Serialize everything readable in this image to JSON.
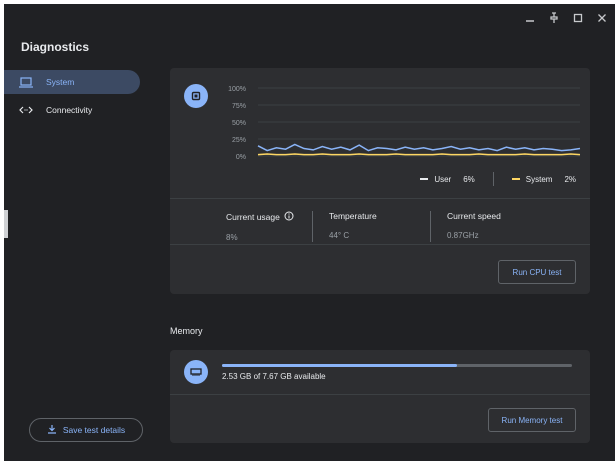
{
  "app": {
    "title": "Diagnostics"
  },
  "window_controls": [
    "minimize",
    "pin",
    "maximize",
    "close"
  ],
  "sidebar": {
    "items": [
      {
        "label": "System",
        "icon": "laptop-icon",
        "active": true
      },
      {
        "label": "Connectivity",
        "icon": "arrows-icon",
        "active": false
      }
    ],
    "save_button": "Save test details"
  },
  "cpu": {
    "y_ticks": [
      "100%",
      "75%",
      "50%",
      "25%",
      "0%"
    ],
    "legend": {
      "user_label": "User",
      "user_value": "6%",
      "system_label": "System",
      "system_value": "2%"
    },
    "stats": {
      "usage_label": "Current usage",
      "usage_value": "8%",
      "temp_label": "Temperature",
      "temp_value": "44° C",
      "speed_label": "Current speed",
      "speed_value": "0.87GHz"
    },
    "run_button": "Run CPU test"
  },
  "memory": {
    "section_title": "Memory",
    "available_text": "2.53 GB of 7.67 GB available",
    "used_fraction": 0.67,
    "run_button": "Run Memory test"
  },
  "colors": {
    "accent": "#8ab4f8",
    "user_line": "#8ab4f8",
    "system_line": "#fdd663"
  },
  "chart_data": {
    "type": "line",
    "ylim": [
      0,
      100
    ],
    "series": [
      {
        "name": "User",
        "values": [
          15,
          8,
          12,
          10,
          17,
          11,
          9,
          14,
          10,
          13,
          9,
          16,
          8,
          12,
          11,
          9,
          13,
          10,
          12,
          9,
          11,
          14,
          10,
          12,
          9,
          11,
          8,
          13,
          10,
          12,
          9,
          11,
          10,
          8,
          9,
          11
        ]
      },
      {
        "name": "System",
        "values": [
          2,
          3,
          2,
          2,
          3,
          2,
          2,
          3,
          2,
          2,
          2,
          3,
          2,
          2,
          2,
          3,
          2,
          2,
          2,
          2,
          3,
          2,
          2,
          2,
          3,
          2,
          2,
          2,
          2,
          3,
          2,
          2,
          2,
          2,
          3,
          2
        ]
      }
    ]
  }
}
